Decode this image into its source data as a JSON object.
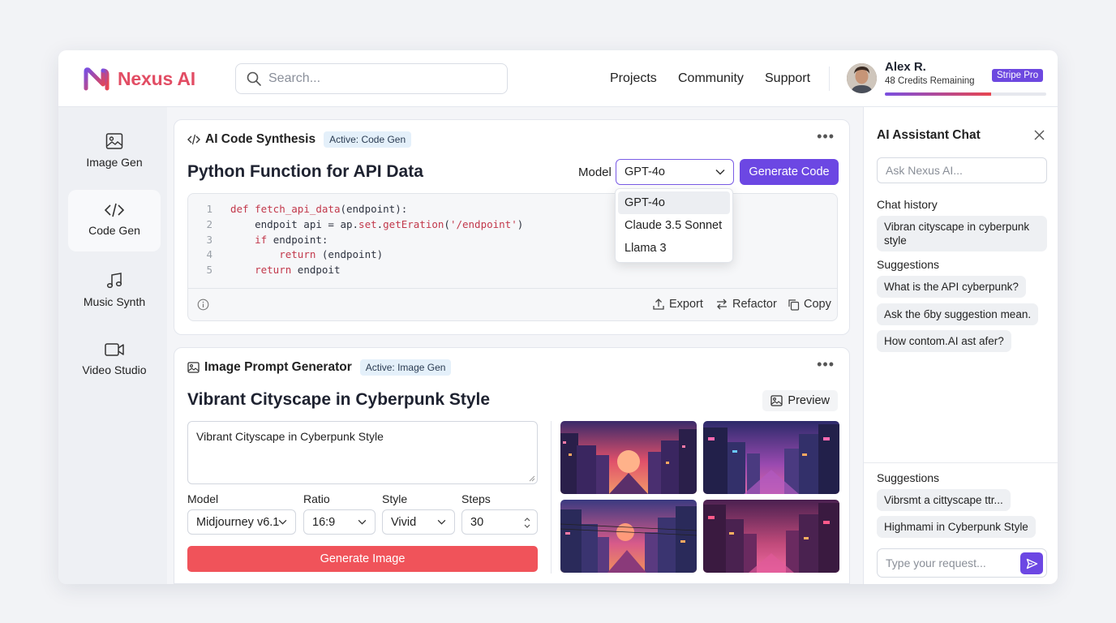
{
  "header": {
    "logo_text": "Nexus AI",
    "search_placeholder": "Search...",
    "nav": [
      "Projects",
      "Community",
      "Support"
    ],
    "user": {
      "name": "Alex R.",
      "credits": "48 Credits Remaining",
      "plan_badge": "Stripe Pro",
      "credits_fraction": 0.66
    }
  },
  "sidebar": {
    "items": [
      {
        "label": "Image Gen",
        "icon": "image-icon"
      },
      {
        "label": "Code Gen",
        "icon": "code-icon",
        "active": true
      },
      {
        "label": "Music Synth",
        "icon": "music-note-icon"
      },
      {
        "label": "Video Studio",
        "icon": "video-camera-icon"
      }
    ]
  },
  "code_card": {
    "title": "AI Code Synthesis",
    "badge": "Active: Code Gen",
    "heading": "Python Function for API Data",
    "model_label": "Model",
    "model_value": "GPT-4o",
    "generate_button": "Generate Code",
    "dropdown_options": [
      "GPT-4o",
      "Claude 3.5 Sonnet",
      "Llama 3"
    ],
    "code_lines": [
      {
        "num": "1",
        "text": "def fetch_api_data(endpoint):"
      },
      {
        "num": "2",
        "text": "    endpoit api = ap.set.getEration('/endpoint')"
      },
      {
        "num": "3",
        "text": "    if endpoint:"
      },
      {
        "num": "4",
        "text": "        return (endpoint)"
      },
      {
        "num": "5",
        "text": "    return endpoit"
      }
    ],
    "footer": {
      "export": "Export",
      "refactor": "Refactor",
      "copy": "Copy"
    }
  },
  "image_card": {
    "title": "Image Prompt Generator",
    "badge": "Active: Image Gen",
    "heading": "Vibrant Cityscape in Cyberpunk Style",
    "preview_button": "Preview",
    "prompt": "Vibrant Cityscape in Cyberpunk Style",
    "fields": {
      "model_label": "Model",
      "model_value": "Midjourney v6.1",
      "ratio_label": "Ratio",
      "ratio_value": "16:9",
      "style_label": "Style",
      "style_value": "Vivid",
      "steps_label": "Steps",
      "steps_value": "30"
    },
    "generate_button": "Generate Image"
  },
  "chat": {
    "title": "AI Assistant Chat",
    "ask_placeholder": "Ask Nexus AI...",
    "history_label": "Chat history",
    "history": [
      "Vibran cityscape in cyberpunk style"
    ],
    "suggestions_label": "Suggestions",
    "suggestions": [
      "What is the API cyberpunk?",
      "Ask the бby suggestion mean.",
      "How contom.AI ast afer?"
    ],
    "suggestions2_label": "Suggestions",
    "suggestions2": [
      "Vibrsmt a cittyscape ttr...",
      "Highmami in Cyberpunk Style"
    ],
    "input_placeholder": "Type your request..."
  },
  "colors": {
    "accent": "#6c47e3",
    "brand": "#e24d64",
    "danger": "#f0535a"
  }
}
